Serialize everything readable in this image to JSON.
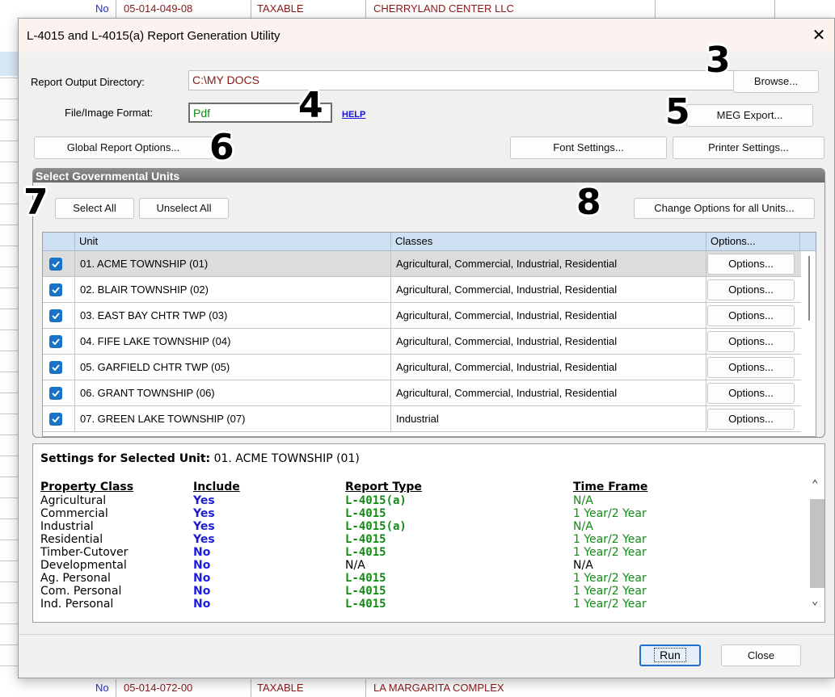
{
  "background_sheet": {
    "top_row": {
      "flag": "No",
      "parcel": "05-014-049-08",
      "status": "TAXABLE",
      "owner": "CHERRYLAND CENTER LLC"
    },
    "bottom_row": {
      "flag": "No",
      "parcel": "05-014-072-00",
      "status": "TAXABLE",
      "owner": "LA MARGARITA COMPLEX"
    }
  },
  "dialog": {
    "title": "L-4015 and L-4015(a) Report Generation Utility",
    "close_glyph": "✕"
  },
  "form": {
    "output_dir_label": "Report Output Directory:",
    "output_dir_value": "C:\\MY DOCS",
    "format_label": "File/Image Format:",
    "format_value": "Pdf",
    "help_link": "HELP",
    "browse_button": "Browse...",
    "meg_export_button": "MEG Export...",
    "global_options_button": "Global Report Options...",
    "font_settings_button": "Font Settings...",
    "printer_settings_button": "Printer Settings..."
  },
  "markers": {
    "m3": "3",
    "m4": "4",
    "m5": "5",
    "m6": "6",
    "m7": "7",
    "m8": "8"
  },
  "units_group": {
    "title": "Select Governmental Units",
    "select_all": "Select All",
    "unselect_all": "Unselect All",
    "change_all": "Change Options for all Units...",
    "columns": {
      "unit": "Unit",
      "classes": "Classes",
      "options": "Options..."
    },
    "rows": [
      {
        "unit": "01. ACME TOWNSHIP (01)",
        "classes": "Agricultural, Commercial, Industrial, Residential",
        "button": "Options...",
        "checked": true
      },
      {
        "unit": "02. BLAIR TOWNSHIP (02)",
        "classes": "Agricultural, Commercial, Industrial, Residential",
        "button": "Options...",
        "checked": true
      },
      {
        "unit": "03. EAST BAY CHTR TWP (03)",
        "classes": "Agricultural, Commercial, Industrial, Residential",
        "button": "Options...",
        "checked": true
      },
      {
        "unit": "04. FIFE LAKE TOWNSHIP (04)",
        "classes": "Agricultural, Commercial, Industrial, Residential",
        "button": "Options...",
        "checked": true
      },
      {
        "unit": "05. GARFIELD CHTR TWP (05)",
        "classes": "Agricultural, Commercial, Industrial, Residential",
        "button": "Options...",
        "checked": true
      },
      {
        "unit": "06. GRANT TOWNSHIP (06)",
        "classes": "Agricultural, Commercial, Industrial, Residential",
        "button": "Options...",
        "checked": true
      },
      {
        "unit": "07. GREEN LAKE TOWNSHIP (07)",
        "classes": "Industrial",
        "button": "Options...",
        "checked": true
      }
    ]
  },
  "settings": {
    "title_prefix": "Settings for Selected Unit:",
    "title_unit": "01. ACME TOWNSHIP (01)",
    "headers": {
      "property_class": "Property Class",
      "include": "Include",
      "report_type": "Report Type",
      "time_frame": "Time Frame"
    },
    "rows": [
      {
        "property_class": "Agricultural",
        "include": "Yes",
        "report_type": "L-4015(a)",
        "time_frame": "N/A"
      },
      {
        "property_class": "Commercial",
        "include": "Yes",
        "report_type": "L-4015",
        "time_frame": "1 Year/2 Year"
      },
      {
        "property_class": "Industrial",
        "include": "Yes",
        "report_type": "L-4015(a)",
        "time_frame": "N/A"
      },
      {
        "property_class": "Residential",
        "include": "Yes",
        "report_type": "L-4015",
        "time_frame": "1 Year/2 Year"
      },
      {
        "property_class": "Timber-Cutover",
        "include": "No",
        "report_type": "L-4015",
        "time_frame": "1 Year/2 Year"
      },
      {
        "property_class": "Developmental",
        "include": "No",
        "report_type": "N/A",
        "time_frame": "N/A"
      },
      {
        "property_class": "Ag. Personal",
        "include": "No",
        "report_type": "L-4015",
        "time_frame": "1 Year/2 Year"
      },
      {
        "property_class": "Com. Personal",
        "include": "No",
        "report_type": "L-4015",
        "time_frame": "1 Year/2 Year"
      },
      {
        "property_class": "Ind. Personal",
        "include": "No",
        "report_type": "L-4015",
        "time_frame": "1 Year/2 Year"
      }
    ],
    "scroll_up": "⌃",
    "scroll_down": "⌄"
  },
  "footer": {
    "run_button": "Run",
    "close_button": "Close"
  }
}
